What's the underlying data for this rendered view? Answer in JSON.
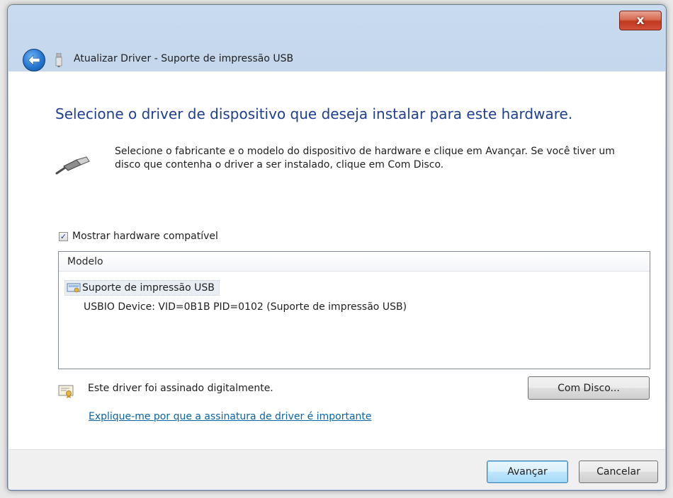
{
  "window": {
    "title": "Atualizar Driver -  Suporte de impressão USB",
    "close_label": "x"
  },
  "page": {
    "heading": "Selecione o driver de dispositivo que deseja instalar para este hardware.",
    "description": "Selecione o fabricante e o modelo do dispositivo de hardware e clique em Avançar. Se você tiver um disco que contenha o driver a ser instalado, clique em Com Disco.",
    "show_compatible": {
      "label": "Mostrar hardware compatível",
      "checked": true,
      "check_glyph": "✓"
    }
  },
  "model_list": {
    "header": "Modelo",
    "items": [
      {
        "label": "Suporte de impressão USB",
        "sublabel": "USBIO Device: VID=0B1B PID=0102 (Suporte de impressão USB)"
      }
    ]
  },
  "signature": {
    "status_text": "Este driver foi assinado digitalmente.",
    "link_text": "Explique-me por que a assinatura de driver é importante"
  },
  "buttons": {
    "have_disk": "Com Disco...",
    "next": "Avançar",
    "cancel": "Cancelar"
  },
  "icons": {
    "back": "back-arrow-icon",
    "usb_title": "usb-plug-icon",
    "usb_large": "usb-cable-icon",
    "device": "printer-device-icon",
    "certificate": "certificate-icon"
  },
  "colors": {
    "heading": "#1e3f8f",
    "link": "#0b63a8",
    "close_button": "#c0391f",
    "primary_button_border": "#3c7fb1"
  }
}
